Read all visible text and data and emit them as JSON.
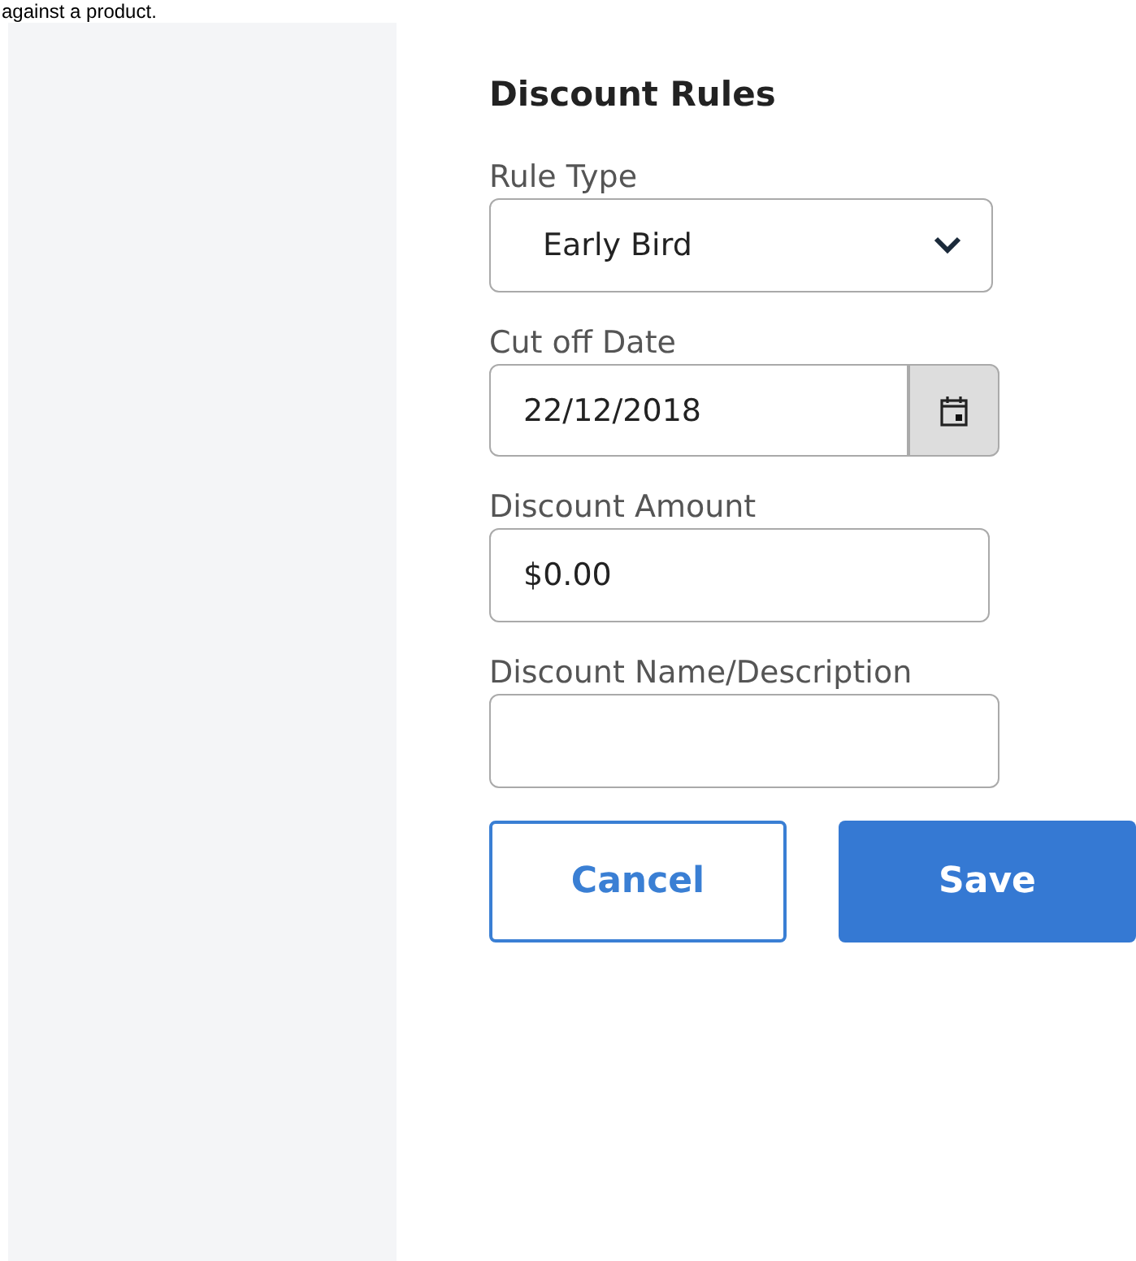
{
  "intro_text": "against a product.",
  "form": {
    "title": "Discount Rules",
    "fields": [
      {
        "kind": "select",
        "label": "Rule Type",
        "value": "Early Bird"
      },
      {
        "kind": "date",
        "label": "Cut off Date",
        "value": "22/12/2018"
      },
      {
        "kind": "text",
        "label": "Discount Amount",
        "value": "$0.00"
      },
      {
        "kind": "text",
        "label": "Discount Name/Description"
      }
    ],
    "buttons": [
      {
        "kind": "secondary",
        "label": "Cancel"
      },
      {
        "kind": "primary",
        "label": "Save"
      }
    ]
  }
}
